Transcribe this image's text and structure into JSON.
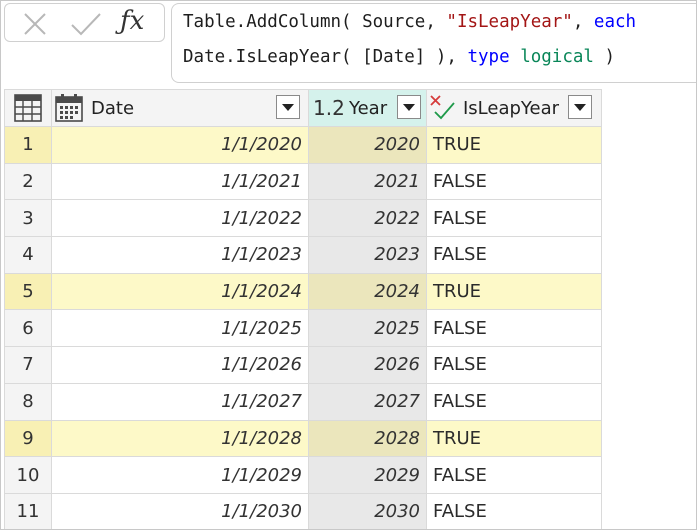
{
  "formula": {
    "line1": {
      "fn": "Table.AddColumn( Source, ",
      "str": "\"IsLeapYear\"",
      "sep": ", ",
      "kw": "each"
    },
    "line2": {
      "fn": "Date.IsLeapYear( [Date] ), ",
      "kw": "type",
      "sp": " ",
      "typ": "logical",
      "end": " )"
    }
  },
  "columns": {
    "date": {
      "label": "Date",
      "type_icon": "calendar-icon"
    },
    "year": {
      "label": "Year",
      "type_badge": "1.2",
      "type_icon": "decimal-number-icon"
    },
    "leap": {
      "label": "IsLeapYear",
      "type_icon": "logical-icon"
    }
  },
  "rows": [
    {
      "n": "1",
      "date": "1/1/2020",
      "year": "2020",
      "leap": "TRUE"
    },
    {
      "n": "2",
      "date": "1/1/2021",
      "year": "2021",
      "leap": "FALSE"
    },
    {
      "n": "3",
      "date": "1/1/2022",
      "year": "2022",
      "leap": "FALSE"
    },
    {
      "n": "4",
      "date": "1/1/2023",
      "year": "2023",
      "leap": "FALSE"
    },
    {
      "n": "5",
      "date": "1/1/2024",
      "year": "2024",
      "leap": "TRUE"
    },
    {
      "n": "6",
      "date": "1/1/2025",
      "year": "2025",
      "leap": "FALSE"
    },
    {
      "n": "7",
      "date": "1/1/2026",
      "year": "2026",
      "leap": "FALSE"
    },
    {
      "n": "8",
      "date": "1/1/2027",
      "year": "2027",
      "leap": "FALSE"
    },
    {
      "n": "9",
      "date": "1/1/2028",
      "year": "2028",
      "leap": "TRUE"
    },
    {
      "n": "10",
      "date": "1/1/2029",
      "year": "2029",
      "leap": "FALSE"
    },
    {
      "n": "11",
      "date": "1/1/2030",
      "year": "2030",
      "leap": "FALSE"
    }
  ],
  "colors": {
    "highlight_row": "#fdf9c8",
    "year_header": "#d5f2ec",
    "keyword": "#0000ff",
    "string": "#a31515",
    "type": "#098658"
  }
}
